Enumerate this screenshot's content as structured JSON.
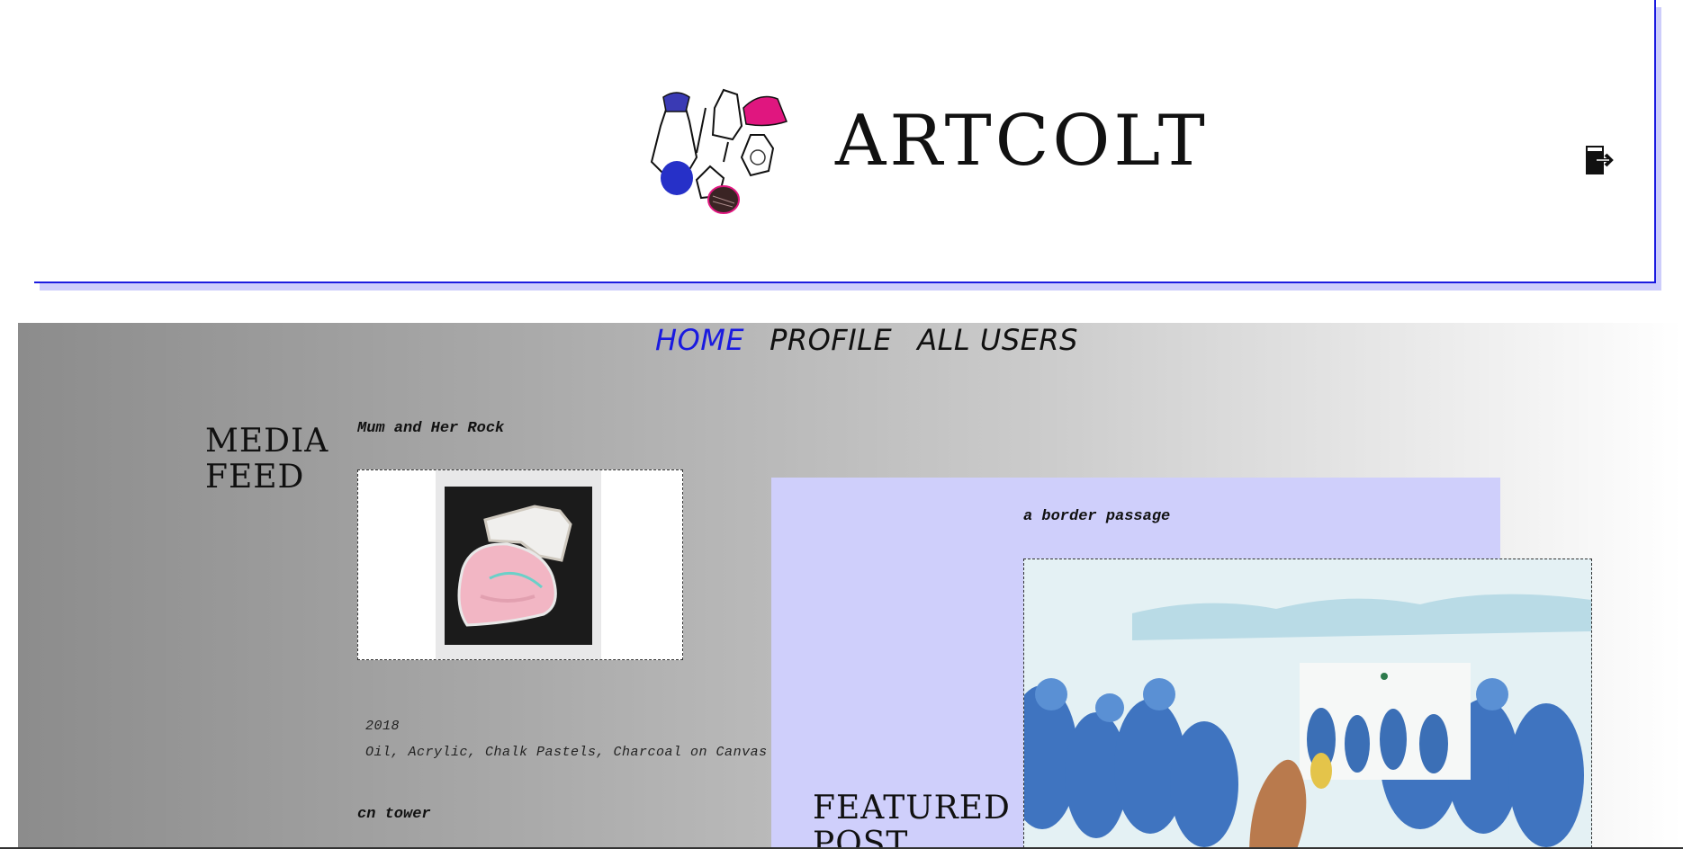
{
  "header": {
    "brand": "ARTCOLT",
    "logo_icon": "artcolt-sketch-logo",
    "logout_icon": "logout-icon"
  },
  "nav": {
    "items": [
      {
        "label": "HOME",
        "active": true
      },
      {
        "label": "PROFILE",
        "active": false
      },
      {
        "label": "ALL USERS",
        "active": false
      }
    ]
  },
  "media_feed": {
    "title": "MEDIA FEED",
    "posts": [
      {
        "title": "Mum and Her Rock",
        "year": "2018",
        "medium": "Oil, Acrylic, Chalk Pastels, Charcoal on Canvas"
      },
      {
        "title": "cn tower"
      }
    ]
  },
  "featured": {
    "title": "FEATURED POST",
    "post_title": "a border passage"
  },
  "colors": {
    "accent": "#1a1ae0",
    "featured_bg": "#cfcffb",
    "header_shadow": "#cdcdfb"
  }
}
